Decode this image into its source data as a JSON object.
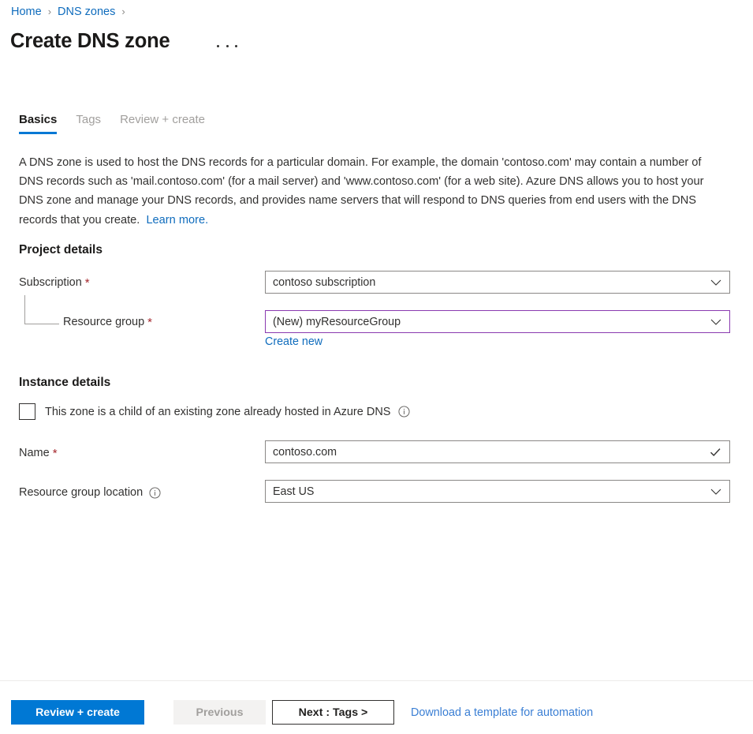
{
  "breadcrumb": {
    "items": [
      {
        "label": "Home"
      },
      {
        "label": "DNS zones"
      }
    ],
    "separator": "›"
  },
  "header": {
    "title": "Create DNS zone",
    "more_menu": "more-options"
  },
  "tabs": [
    {
      "label": "Basics",
      "active": true
    },
    {
      "label": "Tags",
      "active": false
    },
    {
      "label": "Review + create",
      "active": false
    }
  ],
  "description": {
    "text": "A DNS zone is used to host the DNS records for a particular domain. For example, the domain 'contoso.com' may contain a number of DNS records such as 'mail.contoso.com' (for a mail server) and 'www.contoso.com' (for a web site). Azure DNS allows you to host your DNS zone and manage your DNS records, and provides name servers that will respond to DNS queries from end users with the DNS records that you create.",
    "learn_more": "Learn more."
  },
  "project_details": {
    "heading": "Project details",
    "subscription": {
      "label": "Subscription",
      "required": "*",
      "value": "contoso subscription"
    },
    "resource_group": {
      "label": "Resource group",
      "required": "*",
      "value": "(New) myResourceGroup",
      "create_new": "Create new"
    }
  },
  "instance_details": {
    "heading": "Instance details",
    "child_zone_checkbox": {
      "label": "This zone is a child of an existing zone already hosted in Azure DNS",
      "checked": false
    },
    "name": {
      "label": "Name",
      "required": "*",
      "value": "contoso.com"
    },
    "location": {
      "label": "Resource group location",
      "value": "East US"
    }
  },
  "footer": {
    "review_create": "Review + create",
    "previous": "Previous",
    "next": "Next : Tags >",
    "download_template": "Download a template for automation"
  },
  "colors": {
    "accent_blue": "#0078d4",
    "link_blue": "#0f6cbd",
    "required_red": "#a4262c",
    "accent_purple": "#8a3ab0",
    "border_gray": "#8a8886"
  }
}
